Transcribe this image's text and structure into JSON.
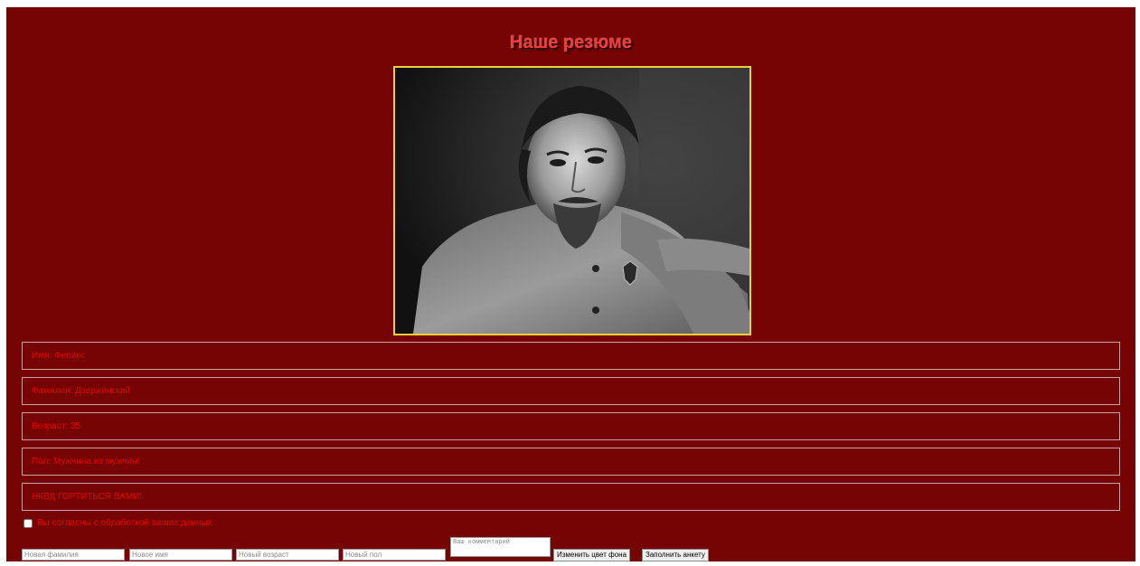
{
  "page": {
    "title": "Наше резюме",
    "background_color": "#760404",
    "text_color": "#e00000",
    "photo_border_color": "#e8d13a"
  },
  "photo": {
    "alt": "Портрет"
  },
  "fields": [
    {
      "label": "Имя: Феликс"
    },
    {
      "label": "Фамилия: Дзержинский"
    },
    {
      "label": "Возраст: 35"
    },
    {
      "label": "Пол: Мужчина из мужчин!"
    },
    {
      "label": "НКВД ГОРТИТЬСЯ ВАМИ!"
    }
  ],
  "consent": {
    "label": "Вы согласны с обработкой ваших данных",
    "checked": false
  },
  "form": {
    "new_surname_placeholder": "Новая фамилия",
    "new_name_placeholder": "Новое имя",
    "new_age_placeholder": "Новый возраст",
    "new_gender_placeholder": "Новый пол",
    "comment_placeholder": "Ваш комментарий",
    "change_bg_button": "Изменить цвет фона",
    "fill_form_button": "Заполнить анкету"
  }
}
